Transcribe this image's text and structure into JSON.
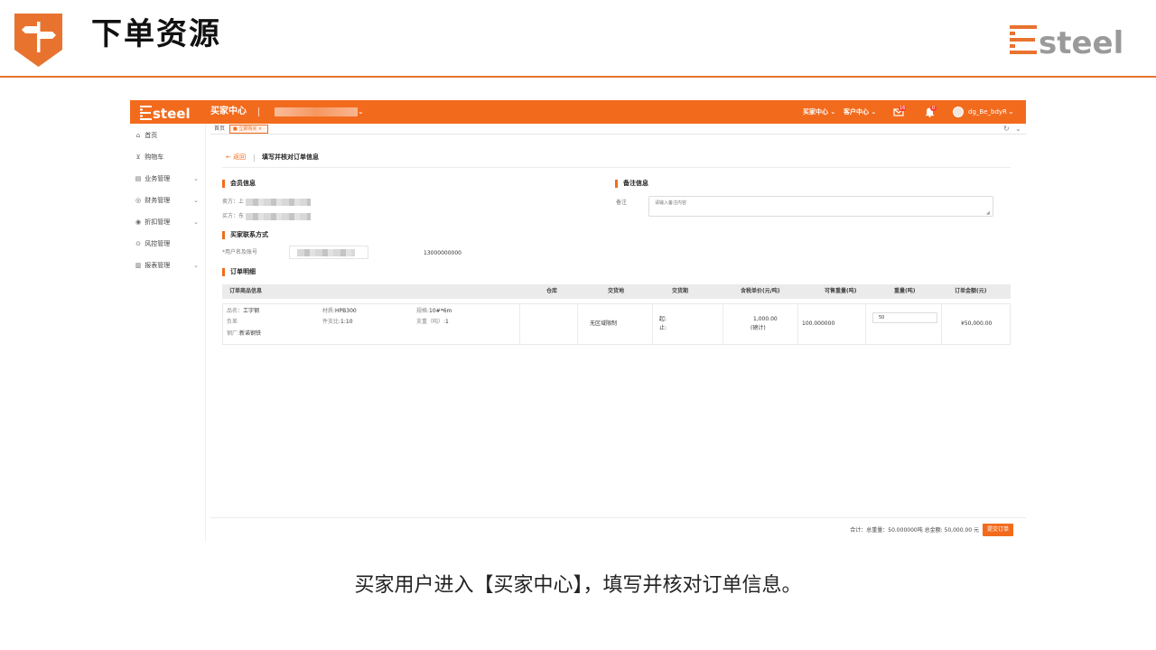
{
  "slide": {
    "title": "下单资源",
    "logo_text": "esteel",
    "caption": "买家用户进入【买家中心】，填写并核对订单信息。",
    "accent": "#e8732f"
  },
  "app": {
    "brand": "esteel",
    "center_title": "买家中心",
    "buyer_center_menu": "买家中心",
    "customer_center_menu": "客户中心",
    "message_badge": "16",
    "notification_badge": "0",
    "username": "dg_Be_bdyR",
    "accent": "#f26b1d",
    "sidebar": [
      {
        "icon": "⌂",
        "label": "首页",
        "has_children": false
      },
      {
        "icon": "⊻",
        "label": "购物车",
        "has_children": false
      },
      {
        "icon": "▤",
        "label": "业务管理",
        "has_children": true
      },
      {
        "icon": "◎",
        "label": "财务管理",
        "has_children": true
      },
      {
        "icon": "◉",
        "label": "折扣管理",
        "has_children": true
      },
      {
        "icon": "⊙",
        "label": "风控管理",
        "has_children": false
      },
      {
        "icon": "▥",
        "label": "报表管理",
        "has_children": true
      }
    ],
    "tabs": {
      "home": "首页",
      "active": "立即购买"
    },
    "page": {
      "back": "← 返回",
      "title": "填写并核对订单信息"
    },
    "member": {
      "title": "会员信息",
      "seller_label": "卖方：上",
      "buyer_label": "买方：东"
    },
    "remark": {
      "title": "备注信息",
      "label": "备注",
      "placeholder": "请输入备注内容"
    },
    "contact": {
      "title": "买家联系方式",
      "label": "*用户名及账号",
      "phone": "13000000000"
    },
    "order": {
      "title": "订单明细",
      "columns": [
        "订单商品信息",
        "仓库",
        "交货地",
        "交货期",
        "含税单价(元/吨)",
        "可售重量(吨)",
        "重量(吨)",
        "订单金额(元)"
      ],
      "row": {
        "name_label": "品名：",
        "name": "工字钢",
        "material_label": "材质:",
        "material": "HPB300",
        "spec_label": "规格:",
        "spec": "10#*6m",
        "tolerance_label": "负差",
        "ratio_label": "件支比:",
        "ratio": "1:10",
        "pieces_label": "支重（吨）:",
        "pieces": "1",
        "mill_label": "钢厂:",
        "mill": "新诺钢铁",
        "delivery_place": "无区域限制",
        "delivery_from": "起:",
        "delivery_to": "止:",
        "unit_price": "1,000.00",
        "price_note": "(磅计)",
        "available_weight": "100.000000",
        "weight": "50",
        "amount": "¥50,000.00"
      }
    },
    "footer": {
      "summary": "合计：总重量：50.000000吨 总金额: 50,000.00 元",
      "submit": "提交订单"
    }
  }
}
